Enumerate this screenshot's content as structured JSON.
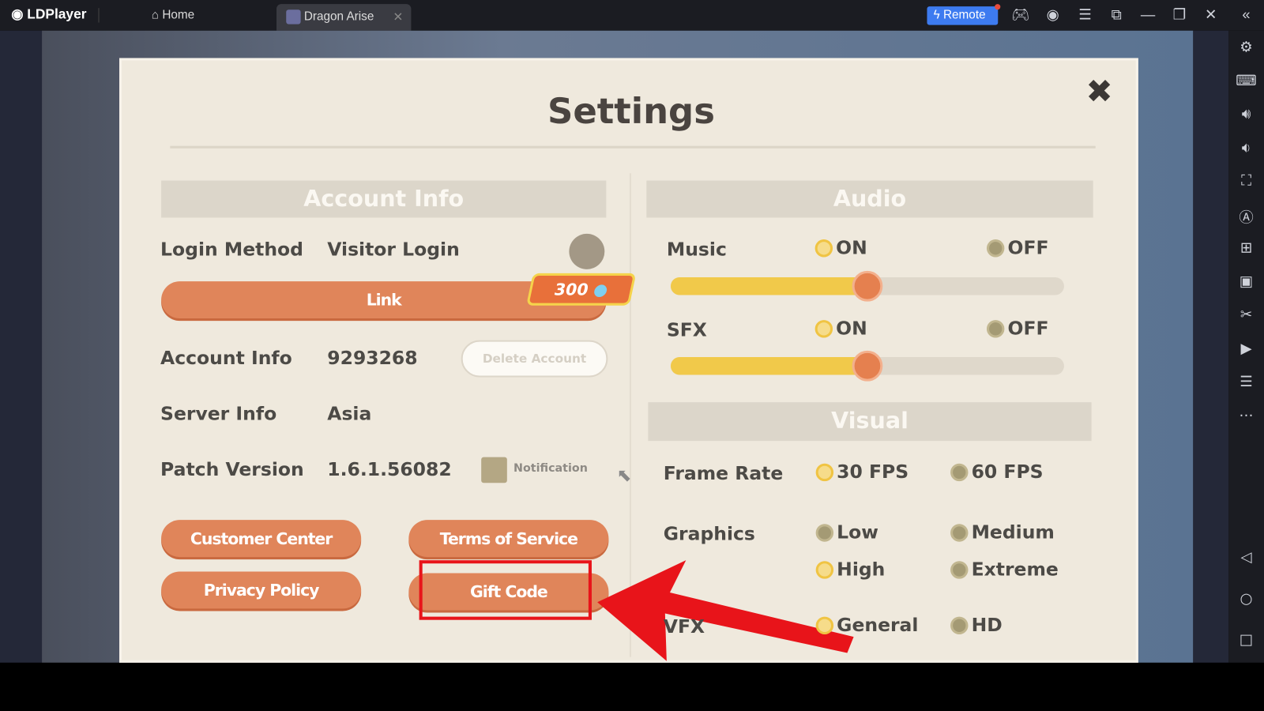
{
  "app": {
    "name": "LDPlayer",
    "tabs": [
      {
        "label": "Home",
        "icon": "home-icon"
      },
      {
        "label": "Dragon Arise",
        "icon": "game-icon"
      }
    ],
    "remote_label": "Remote",
    "accent": "#3d7bf0"
  },
  "sidebar_icons": [
    "settings-icon",
    "keyboard-icon",
    "volume-up-icon",
    "volume-down-icon",
    "screenshot-icon",
    "auto-icon",
    "add-window-icon",
    "apk-icon",
    "scissors-icon",
    "record-icon",
    "sync-icon",
    "more-icon",
    "back-icon",
    "home-circle-icon",
    "recents-icon"
  ],
  "settings": {
    "title": "Settings",
    "account": {
      "header": "Account Info",
      "login_label": "Login Method",
      "login_value": "Visitor Login",
      "link_label": "Link",
      "reward": "300",
      "account_label": "Account Info",
      "account_value": "9293268",
      "delete_label": "Delete Account",
      "server_label": "Server Info",
      "server_value": "Asia",
      "patch_label": "Patch Version",
      "patch_value": "1.6.1.56082",
      "notification_label": "Notification",
      "buttons": {
        "customer": "Customer Center",
        "terms": "Terms of Service",
        "privacy": "Privacy Policy",
        "gift": "Gift Code"
      }
    },
    "audio": {
      "header": "Audio",
      "music_label": "Music",
      "sfx_label": "SFX",
      "on": "ON",
      "off": "OFF",
      "music_level": 0.5,
      "sfx_level": 0.5
    },
    "visual": {
      "header": "Visual",
      "frame_label": "Frame Rate",
      "fps30": "30 FPS",
      "fps60": "60 FPS",
      "graphics_label": "Graphics",
      "low": "Low",
      "medium": "Medium",
      "high": "High",
      "extreme": "Extreme",
      "vfx_label": "VFX",
      "general": "General",
      "hd": "HD"
    }
  },
  "annotation_color": "#e8141a"
}
